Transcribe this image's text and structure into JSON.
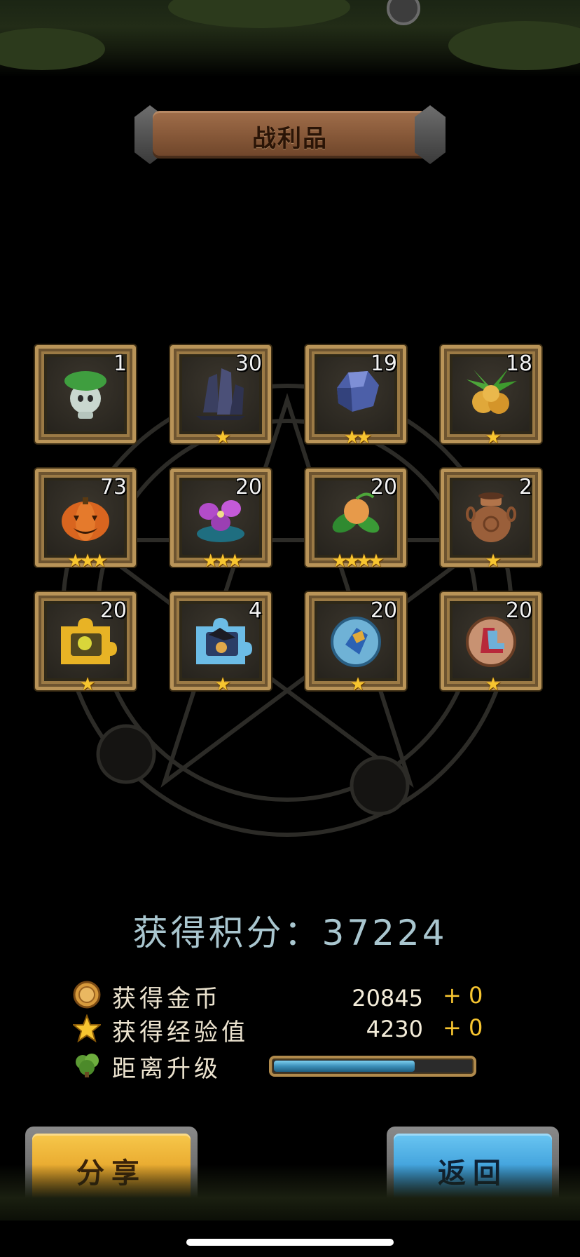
{
  "header": {
    "title": "战利品"
  },
  "loot": [
    {
      "icon": "leaf-sprite-icon",
      "count": "1",
      "stars": 0
    },
    {
      "icon": "dark-crystal-icon",
      "count": "30",
      "stars": 1
    },
    {
      "icon": "blue-ore-icon",
      "count": "19",
      "stars": 2
    },
    {
      "icon": "golden-fruit-icon",
      "count": "18",
      "stars": 1
    },
    {
      "icon": "pumpkin-icon",
      "count": "73",
      "stars": 3
    },
    {
      "icon": "purple-flower-icon",
      "count": "20",
      "stars": 3
    },
    {
      "icon": "orange-bud-icon",
      "count": "20",
      "stars": 4
    },
    {
      "icon": "clay-pot-icon",
      "count": "2",
      "stars": 1
    },
    {
      "icon": "gold-puzzle-icon",
      "count": "20",
      "stars": 1
    },
    {
      "icon": "blue-puzzle-icon",
      "count": "4",
      "stars": 1
    },
    {
      "icon": "blue-gem-orb-icon",
      "count": "20",
      "stars": 1
    },
    {
      "icon": "boots-orb-icon",
      "count": "20",
      "stars": 1
    }
  ],
  "score": {
    "text": "获得积分：37224"
  },
  "stats": {
    "coins": {
      "label": "获得金币",
      "value": "20845",
      "bonus": "+ 0",
      "icon": "coin-icon"
    },
    "exp": {
      "label": "获得经验值",
      "value": "4230",
      "bonus": "+ 0",
      "icon": "star-icon"
    },
    "level": {
      "label": "距离升级",
      "icon": "tree-icon",
      "progress": 0.72
    }
  },
  "buttons": {
    "share": "分享",
    "back": "返回"
  },
  "colors": {
    "gold_frame": "#b99458",
    "star": "#f7c530",
    "share_btn": "#e6a42a",
    "back_btn": "#3a9bd8",
    "score_text": "#a9c6cf"
  }
}
